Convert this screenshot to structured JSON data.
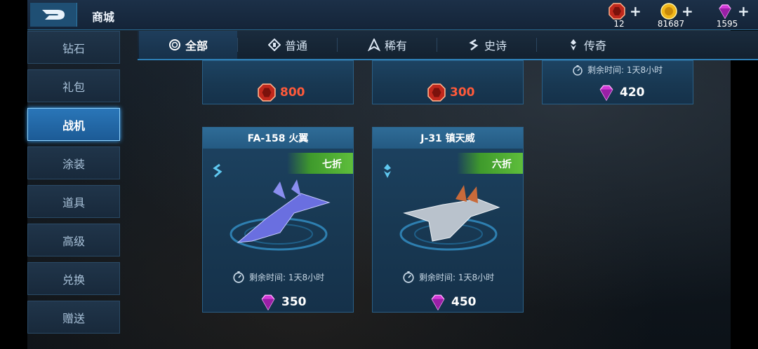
{
  "header": {
    "title": "商城",
    "currencies": [
      {
        "icon": "red-crystal-icon",
        "value": "12",
        "plus": "+"
      },
      {
        "icon": "gold-coin-icon",
        "value": "81687",
        "plus": "+"
      },
      {
        "icon": "purple-gem-icon",
        "value": "1595",
        "plus": "+"
      }
    ]
  },
  "sidebar": {
    "items": [
      {
        "label": "钻石",
        "active": false
      },
      {
        "label": "礼包",
        "active": false
      },
      {
        "label": "战机",
        "active": true
      },
      {
        "label": "涂装",
        "active": false
      },
      {
        "label": "道具",
        "active": false
      },
      {
        "label": "高级",
        "active": false
      },
      {
        "label": "兑换",
        "active": false
      },
      {
        "label": "赠送",
        "active": false
      }
    ]
  },
  "tabs": [
    {
      "label": "全部",
      "icon": "ring-icon",
      "active": true
    },
    {
      "label": "普通",
      "icon": "common-rarity-icon",
      "active": false
    },
    {
      "label": "稀有",
      "icon": "rare-rarity-icon",
      "active": false
    },
    {
      "label": "史诗",
      "icon": "epic-rarity-icon",
      "active": false
    },
    {
      "label": "传奇",
      "icon": "legendary-rarity-icon",
      "active": false
    }
  ],
  "top_cards": [
    {
      "price": "800",
      "currency": "red-crystal-icon"
    },
    {
      "price": "300",
      "currency": "red-crystal-icon"
    },
    {
      "price": "420",
      "currency": "purple-gem-icon",
      "timer": "剩余时间: 1天8小时"
    }
  ],
  "cards": [
    {
      "name": "FA-158 火翼",
      "discount": "七折",
      "rarity_icon": "epic-rarity-icon",
      "timer": "剩余时间: 1天8小时",
      "price": "350",
      "currency": "purple-gem-icon",
      "jet_color": "#6a6fe0"
    },
    {
      "name": "J-31 镇天威",
      "discount": "六折",
      "rarity_icon": "legendary-rarity-icon",
      "timer": "剩余时间: 1天8小时",
      "price": "450",
      "currency": "purple-gem-icon",
      "jet_color": "#b9c2cc"
    }
  ]
}
